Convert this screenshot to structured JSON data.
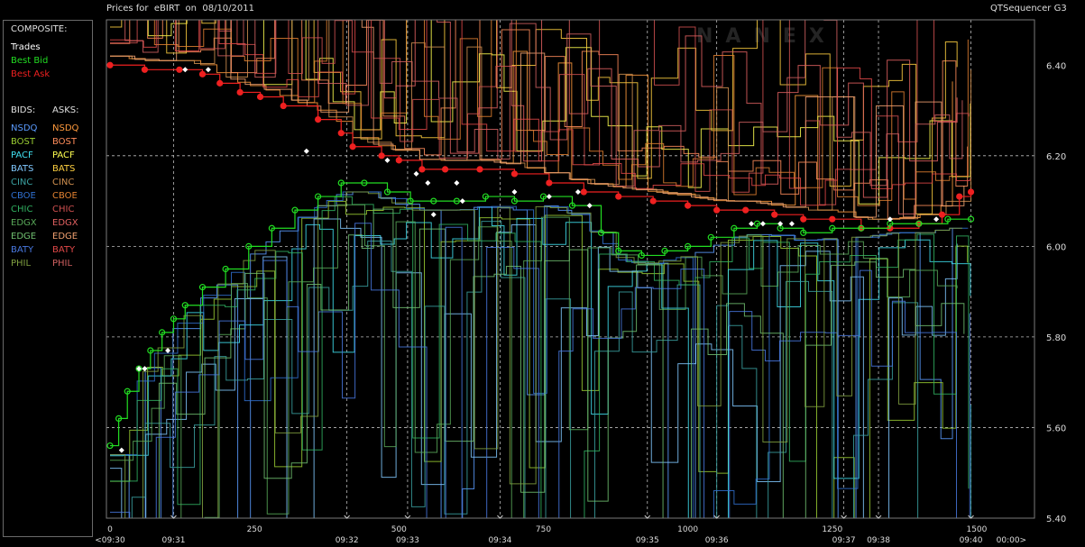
{
  "window": {
    "title": "Prices for  eBIRT  on  08/10/2011",
    "right_title": "QTSequencer G3",
    "watermark": "NANEX"
  },
  "legend": {
    "composite_header": "COMPOSITE:",
    "trades_label": "Trades",
    "best_bid_label": "Best Bid",
    "best_ask_label": "Best Ask",
    "bids_header": "BIDS:",
    "asks_header": "ASKS:",
    "exchanges": [
      {
        "bid": "NSDQ",
        "ask": "NSDQ",
        "bid_color": "#5a9bff",
        "ask_color": "#ff9a3c"
      },
      {
        "bid": "BOST",
        "ask": "BOST",
        "bid_color": "#9acd32",
        "ask_color": "#ff8c5a"
      },
      {
        "bid": "PACF",
        "ask": "PACF",
        "bid_color": "#40e0f0",
        "ask_color": "#ffff50"
      },
      {
        "bid": "BATS",
        "ask": "BATS",
        "bid_color": "#80c8ff",
        "ask_color": "#ffd040"
      },
      {
        "bid": "CINC",
        "ask": "CINC",
        "bid_color": "#3aa0a0",
        "ask_color": "#d09050"
      },
      {
        "bid": "CBOE",
        "ask": "CBOE",
        "bid_color": "#3070d0",
        "ask_color": "#e08030"
      },
      {
        "bid": "CHIC",
        "ask": "CHIC",
        "bid_color": "#30b060",
        "ask_color": "#d05050"
      },
      {
        "bid": "EDGX",
        "ask": "EDGX",
        "bid_color": "#58a858",
        "ask_color": "#e06060"
      },
      {
        "bid": "EDGE",
        "ask": "EDGE",
        "bid_color": "#70c070",
        "ask_color": "#f0a070"
      },
      {
        "bid": "BATY",
        "ask": "BATY",
        "bid_color": "#4878e0",
        "ask_color": "#e04848"
      },
      {
        "bid": "PHIL",
        "ask": "PHIL",
        "bid_color": "#80a040",
        "ask_color": "#d06060"
      }
    ]
  },
  "colors": {
    "best_bid": "#22dd22",
    "best_ask": "#ee2020",
    "trades": "#ffffff",
    "grid": "#bcbcbc",
    "border": "#7a7a7a"
  },
  "chart_data": {
    "type": "line",
    "title": "Prices for  eBIRT  on  08/10/2011",
    "xlabel": "",
    "ylabel": "",
    "xlim": [
      0,
      1600
    ],
    "ylim": [
      5.4,
      6.5
    ],
    "y_ticks": [
      "6.40",
      "6.20",
      "6.00",
      "5.80",
      "5.60",
      "5.40"
    ],
    "y_tick_values": [
      6.4,
      6.2,
      6.0,
      5.8,
      5.6,
      5.4
    ],
    "x_ticks": [
      "0",
      "250",
      "500",
      "750",
      "1000",
      "1250",
      "1500"
    ],
    "x_tick_values": [
      0,
      250,
      500,
      750,
      1000,
      1250,
      1500
    ],
    "time_labels": [
      {
        "x": 0,
        "label": "<09:30"
      },
      {
        "x": 110,
        "label": "09:31"
      },
      {
        "x": 410,
        "label": "09:32"
      },
      {
        "x": 515,
        "label": "09:33"
      },
      {
        "x": 675,
        "label": "09:34"
      },
      {
        "x": 930,
        "label": "09:35"
      },
      {
        "x": 1050,
        "label": "09:36"
      },
      {
        "x": 1270,
        "label": "09:37"
      },
      {
        "x": 1330,
        "label": "09:38"
      },
      {
        "x": 1490,
        "label": "09:40"
      },
      {
        "x": 1560,
        "label": "00:00>"
      }
    ],
    "grid": "dotted",
    "series": [
      {
        "name": "Best Ask",
        "x": [
          0,
          60,
          120,
          160,
          190,
          225,
          260,
          300,
          360,
          400,
          420,
          470,
          500,
          540,
          580,
          640,
          700,
          760,
          820,
          880,
          940,
          1000,
          1050,
          1100,
          1150,
          1200,
          1250,
          1300,
          1350,
          1400,
          1440,
          1470,
          1490
        ],
        "values": [
          6.4,
          6.39,
          6.39,
          6.38,
          6.36,
          6.34,
          6.33,
          6.31,
          6.28,
          6.25,
          6.22,
          6.2,
          6.19,
          6.17,
          6.17,
          6.17,
          6.16,
          6.14,
          6.12,
          6.11,
          6.1,
          6.09,
          6.08,
          6.08,
          6.07,
          6.06,
          6.06,
          6.04,
          6.04,
          6.05,
          6.07,
          6.11,
          6.12
        ]
      },
      {
        "name": "Best Bid",
        "x": [
          0,
          15,
          30,
          50,
          70,
          90,
          110,
          130,
          160,
          200,
          240,
          280,
          320,
          360,
          400,
          440,
          480,
          520,
          560,
          600,
          650,
          700,
          750,
          800,
          850,
          880,
          920,
          960,
          1000,
          1040,
          1080,
          1120,
          1160,
          1200,
          1250,
          1300,
          1350,
          1400,
          1450,
          1490
        ],
        "values": [
          5.56,
          5.62,
          5.68,
          5.73,
          5.77,
          5.81,
          5.84,
          5.87,
          5.91,
          5.95,
          6.0,
          6.04,
          6.08,
          6.11,
          6.14,
          6.14,
          6.12,
          6.1,
          6.1,
          6.1,
          6.11,
          6.1,
          6.11,
          6.09,
          6.03,
          5.99,
          5.98,
          5.99,
          6.0,
          6.02,
          6.04,
          6.05,
          6.04,
          6.03,
          6.04,
          6.04,
          6.05,
          6.05,
          6.06,
          6.06
        ]
      },
      {
        "name": "Trades",
        "x": [
          20,
          50,
          60,
          100,
          130,
          170,
          340,
          480,
          530,
          550,
          560,
          600,
          610,
          700,
          760,
          810,
          830,
          1110,
          1130,
          1160,
          1180,
          1350,
          1430
        ],
        "values": [
          5.55,
          5.73,
          5.73,
          5.77,
          6.39,
          6.39,
          6.21,
          6.19,
          6.16,
          6.14,
          6.07,
          6.14,
          6.1,
          6.12,
          6.11,
          6.12,
          6.09,
          6.05,
          6.05,
          6.05,
          6.05,
          6.06,
          6.06
        ]
      }
    ]
  }
}
